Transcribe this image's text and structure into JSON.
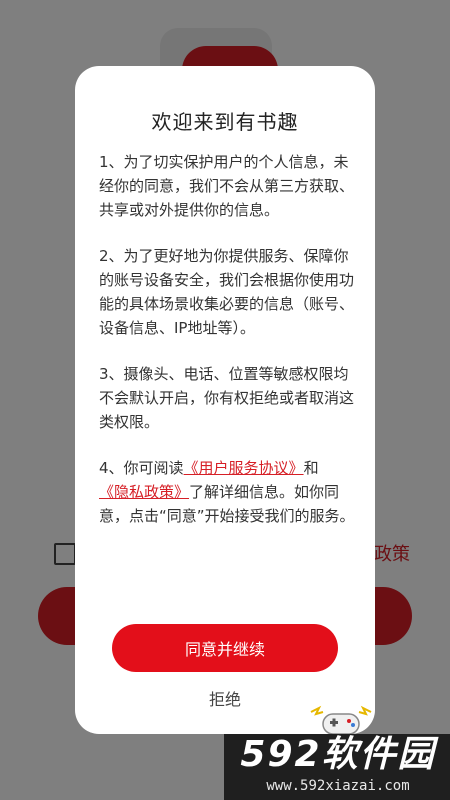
{
  "background": {
    "privacy_text": "政策",
    "accent_color": "#d61f26"
  },
  "dialog": {
    "title": "欢迎来到有书趣",
    "paragraph_1": "1、为了切实保护用户的个人信息，未经你的同意，我们不会从第三方获取、共享或对外提供你的信息。",
    "paragraph_2": "2、为了更好地为你提供服务、保障你的账号设备安全，我们会根据你使用功能的具体场景收集必要的信息（账号、设备信息、IP地址等）。",
    "paragraph_3": "3、摄像头、电话、位置等敏感权限均不会默认开启，你有权拒绝或者取消这类权限。",
    "paragraph_4": {
      "prefix": "4、你可阅读",
      "service_link": "《用户服务协议》",
      "middle": "和",
      "privacy_link": "《隐私政策》",
      "suffix": "了解详细信息。如你同意，点击“同意”开始接受我们的服务。"
    },
    "agree_button": "同意并继续",
    "reject_button": "拒绝"
  },
  "watermark": {
    "brand": "592软件园",
    "url": "www.592xiazai.com"
  }
}
